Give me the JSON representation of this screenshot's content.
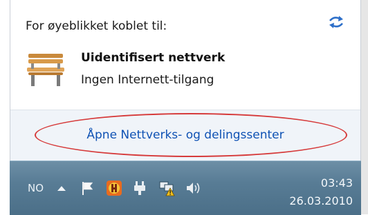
{
  "popup": {
    "header": "For øyeblikket koblet til:",
    "network": {
      "name": "Uidentifisert nettverk",
      "status": "Ingen Internett-tilgang"
    },
    "footer_link": "Åpne Nettverks- og delingssenter"
  },
  "taskbar": {
    "language": "NO",
    "time": "03:43",
    "date": "26.03.2010",
    "tray_icons": [
      "show-hidden-icons",
      "action-center-flag",
      "app-tray",
      "power",
      "network-warning",
      "volume"
    ]
  },
  "colors": {
    "link": "#0f52b4",
    "highlight": "#d63a3a",
    "taskbar": "#587c95"
  }
}
